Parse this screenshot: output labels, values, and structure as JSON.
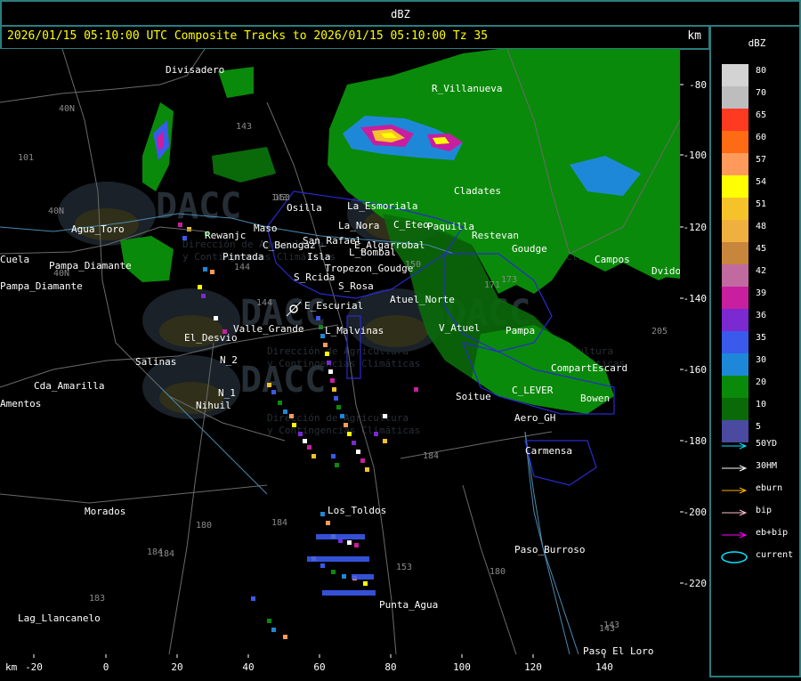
{
  "header": {
    "title": "dBZ"
  },
  "info": {
    "text": "2026/01/15 05:10:00 UTC Composite Tracks to 2026/01/15 05:10:00 Tz 35",
    "km_label": "km"
  },
  "legend": {
    "title": "dBZ",
    "scale": [
      {
        "value": "80",
        "color": "#d3d3d3"
      },
      {
        "value": "70",
        "color": "#bdbdbd"
      },
      {
        "value": "65",
        "color": "#ff3a22"
      },
      {
        "value": "60",
        "color": "#ff6a14"
      },
      {
        "value": "57",
        "color": "#ff9a5a"
      },
      {
        "value": "54",
        "color": "#ffff00"
      },
      {
        "value": "51",
        "color": "#f5c22a"
      },
      {
        "value": "48",
        "color": "#f0b040"
      },
      {
        "value": "45",
        "color": "#c8863c"
      },
      {
        "value": "42",
        "color": "#c06aa0"
      },
      {
        "value": "39",
        "color": "#c81ea0"
      },
      {
        "value": "36",
        "color": "#7a2ad0"
      },
      {
        "value": "35",
        "color": "#3a5aec"
      },
      {
        "value": "30",
        "color": "#1e88d8"
      },
      {
        "value": "20",
        "color": "#0a8a0a"
      },
      {
        "value": "10",
        "color": "#0a6a0a"
      },
      {
        "value": "5",
        "color": "#4a4aa0"
      }
    ],
    "tracks": [
      {
        "label": "50YD",
        "color": "#00e5ff"
      },
      {
        "label": "30HM",
        "color": "#ffffff"
      },
      {
        "label": "eburn",
        "color": "#ffb000"
      },
      {
        "label": "bip",
        "color": "#ffc0cb"
      },
      {
        "label": "eb+bip",
        "color": "#ff00ff"
      },
      {
        "label": "current",
        "color": "#00e5ff"
      }
    ]
  },
  "axes": {
    "x_unit": "km",
    "x_ticks": [
      "-20",
      "0",
      "20",
      "40",
      "60",
      "80",
      "100",
      "120",
      "140"
    ],
    "y_ticks": [
      "-80",
      "-100",
      "-120",
      "-140",
      "-160",
      "-180",
      "-200",
      "-220"
    ]
  },
  "map": {
    "places": [
      "Divisadero",
      "R_Villanueva",
      "Cladates",
      "Agua_Toro",
      "Osilla",
      "La_Esmoriala",
      "C_Eteo",
      "Paquilla",
      "Restevan",
      "Rewanjc",
      "Maso",
      "San_Rafael",
      "C_Benogaz",
      "La_Nora",
      "E_Algarrobal",
      "Goudge",
      "Campos",
      "Dvido",
      "Pampa_Diamante",
      "Pampa_Diamante",
      "Pintada",
      "Isla",
      "L_Bombal",
      "Tropezon_Goudge",
      "S_Rcida",
      "S_Rosa",
      "Atuel_Norte",
      "E_Escurial",
      "Valle_Grande",
      "L_Malvinas",
      "V_Atuel",
      "Pampa",
      "El_Desvio",
      "Salinas",
      "N_2",
      "CompartEscard",
      "Cda_Amarilla",
      "N_1",
      "Nihuil",
      "Soitue",
      "C_LEVER",
      "Bowen",
      "Aero_GH",
      "Carmensa",
      "Morados",
      "Los_Toldos",
      "Paso_Burroso",
      "Punta_Agua",
      "Lag_Llancanelo",
      "Paso_El_Loro",
      "Amentos",
      "Cuela"
    ],
    "route_numbers": [
      "143",
      "143",
      "143",
      "101",
      "40N",
      "40N",
      "40N",
      "153",
      "150",
      "144",
      "144",
      "173",
      "171",
      "205",
      "184",
      "184",
      "180",
      "184",
      "153",
      "183",
      "180",
      "184",
      "143"
    ],
    "watermark": {
      "brand": "DACC",
      "line1": "Dirección de Agricultura",
      "line2": "y Contingencias Climáticas"
    }
  }
}
